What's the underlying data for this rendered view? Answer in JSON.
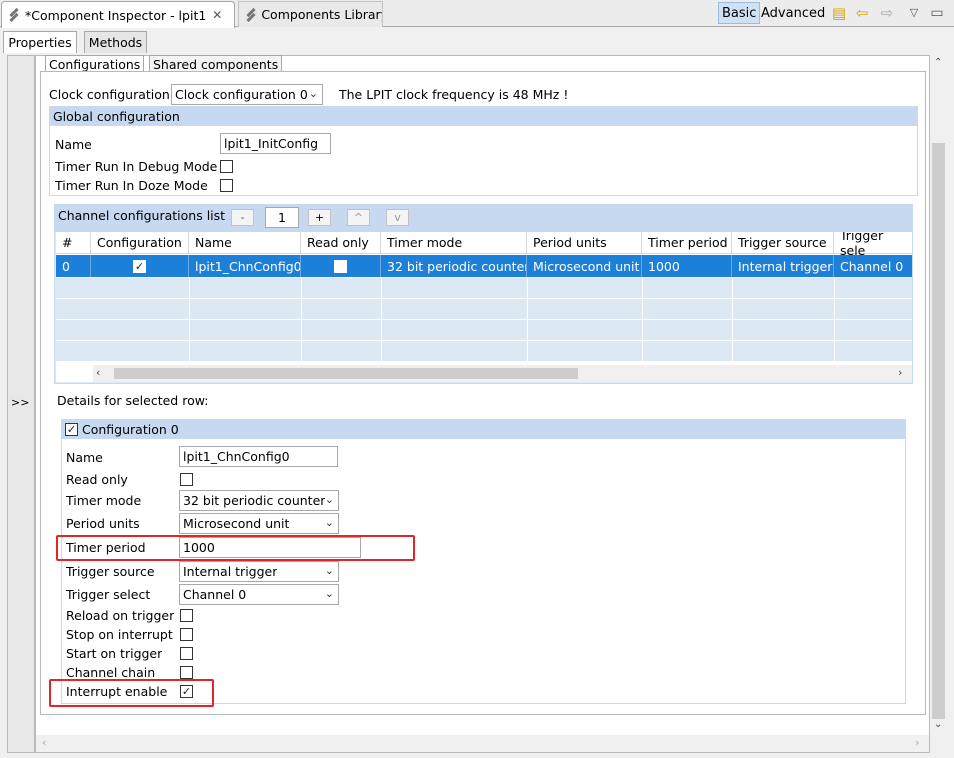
{
  "tabs": {
    "inspector_label": "*Component Inspector - lpit1",
    "library_label": "Components Library"
  },
  "modes": {
    "basic": "Basic",
    "advanced": "Advanced"
  },
  "subtabs": {
    "properties": "Properties",
    "methods": "Methods"
  },
  "expand_label": ">>",
  "inner_tabs": {
    "configurations": "Configurations",
    "shared": "Shared components"
  },
  "clock": {
    "label": "Clock configuration",
    "value": "Clock configuration 0",
    "frequency_text": "The LPIT clock frequency is 48 MHz !"
  },
  "global": {
    "header": "Global configuration",
    "name_label": "Name",
    "name_value": "lpit1_InitConfig",
    "debug_label": "Timer Run In Debug Mode",
    "doze_label": "Timer Run In Doze Mode"
  },
  "channels": {
    "header": "Channel configurations list",
    "minus": "-",
    "count": "1",
    "plus": "+",
    "up": "^",
    "down": "v",
    "columns": [
      "#",
      "Configuration",
      "Name",
      "Read only",
      "Timer mode",
      "Period units",
      "Timer period",
      "Trigger source",
      "Trigger sele"
    ],
    "row": {
      "index": "0",
      "configuration_checked": true,
      "name": "lpit1_ChnConfig0",
      "read_only_checked": false,
      "timer_mode": "32 bit periodic counter",
      "period_units": "Microsecond unit",
      "timer_period": "1000",
      "trigger_source": "Internal trigger",
      "trigger_select": "Channel 0"
    }
  },
  "details": {
    "heading": "Details for selected row:",
    "group_label": "Configuration 0",
    "group_checked": true,
    "name_label": "Name",
    "name_value": "lpit1_ChnConfig0",
    "read_only_label": "Read only",
    "timer_mode_label": "Timer mode",
    "timer_mode_value": "32 bit periodic counter",
    "period_units_label": "Period units",
    "period_units_value": "Microsecond unit",
    "timer_period_label": "Timer period",
    "timer_period_value": "1000",
    "trigger_source_label": "Trigger source",
    "trigger_source_value": "Internal trigger",
    "trigger_select_label": "Trigger select",
    "trigger_select_value": "Channel 0",
    "reload_label": "Reload on trigger",
    "stop_label": "Stop on interrupt",
    "start_label": "Start on trigger",
    "chain_label": "Channel chain",
    "interrupt_label": "Interrupt enable",
    "interrupt_checked": true
  },
  "colors": {
    "selection": "#1d80d8",
    "section_header": "#c6d9f0",
    "highlight_box": "#e0262a"
  }
}
